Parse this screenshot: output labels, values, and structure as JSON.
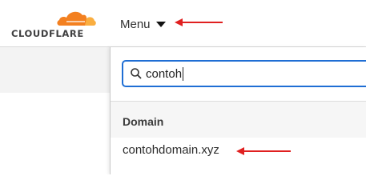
{
  "brand": {
    "logo_text": "CLOUDFLARE",
    "cloud_primary_color": "#F38020",
    "cloud_secondary_color": "#FAAE40"
  },
  "header": {
    "menu_label": "Menu",
    "menu_icon": "caret-down-icon"
  },
  "search": {
    "value": "contoh",
    "icon": "search-icon",
    "border_color": "#1F6ED4"
  },
  "results": {
    "section_title": "Domain",
    "items": [
      {
        "label": "contohdomain.xyz"
      }
    ]
  },
  "annotations": {
    "arrow_color": "#E02020"
  }
}
